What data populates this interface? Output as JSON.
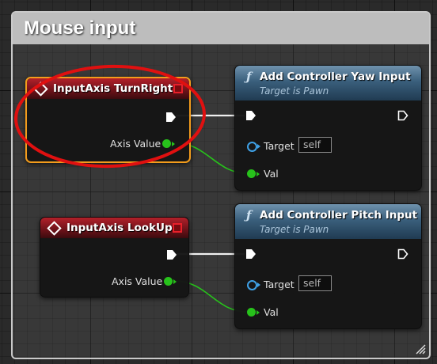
{
  "comment": {
    "title": "Mouse input"
  },
  "nodes": {
    "turn_right": {
      "title": "InputAxis TurnRight",
      "axis_value_label": "Axis Value"
    },
    "look_up": {
      "title": "InputAxis LookUp",
      "axis_value_label": "Axis Value"
    },
    "yaw": {
      "title": "Add Controller Yaw Input",
      "subtitle": "Target is Pawn",
      "target_label": "Target",
      "target_value": "self",
      "val_label": "Val"
    },
    "pitch": {
      "title": "Add Controller Pitch Input",
      "subtitle": "Target is Pawn",
      "target_label": "Target",
      "target_value": "self",
      "val_label": "Val"
    }
  },
  "colors": {
    "event_header": "#b3202a",
    "function_header": "#3a5f7c",
    "selection_outline": "#f39c1c",
    "float_pin": "#27c21b",
    "object_pin": "#3fa1e6",
    "annotation_ellipse": "#e01010"
  },
  "icons": {
    "event_node": "diamond-icon",
    "function_node": "function-f-icon",
    "exec_pin": "exec-arrow-icon"
  }
}
